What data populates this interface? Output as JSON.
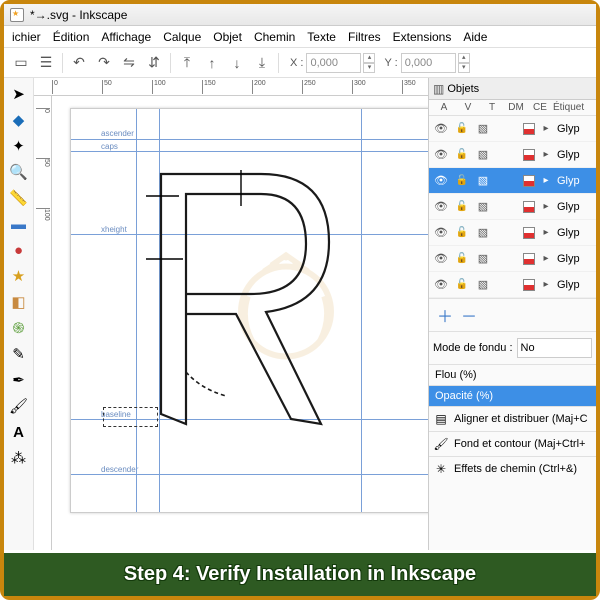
{
  "title": "*→.svg - Inkscape",
  "menu": [
    "ichier",
    "Édition",
    "Affichage",
    "Calque",
    "Objet",
    "Chemin",
    "Texte",
    "Filtres",
    "Extensions",
    "Aide"
  ],
  "coords": {
    "x_label": "X :",
    "x_val": "0,000",
    "y_label": "Y :",
    "y_val": "0,000"
  },
  "ruler_h": [
    "0",
    "50",
    "100",
    "150",
    "200",
    "250",
    "300",
    "350"
  ],
  "ruler_v": [
    "0",
    "50",
    "100"
  ],
  "guides": {
    "ascender": "ascender",
    "caps": "caps",
    "xheight": "xheight",
    "baseline": "baseline",
    "descender": "descender"
  },
  "objects_panel": {
    "title": "Objets",
    "cols": [
      "A",
      "V",
      "T",
      "DM",
      "CE"
    ],
    "label_col": "Étiquet",
    "rows": [
      {
        "name": "Glyp",
        "sel": false
      },
      {
        "name": "Glyp",
        "sel": false
      },
      {
        "name": "Glyp",
        "sel": true
      },
      {
        "name": "Glyp",
        "sel": false
      },
      {
        "name": "Glyp",
        "sel": false
      },
      {
        "name": "Glyp",
        "sel": false
      },
      {
        "name": "Glyp",
        "sel": false
      }
    ],
    "blend_label": "Mode de fondu :",
    "blend_value": "No",
    "blur": "Flou (%)",
    "opacity": "Opacité (%)",
    "align": "Aligner et distribuer (Maj+C",
    "fill": "Fond et contour (Maj+Ctrl+",
    "fx": "Effets de chemin (Ctrl+&)"
  },
  "footer": "Step 4: Verify Installation in Inkscape"
}
